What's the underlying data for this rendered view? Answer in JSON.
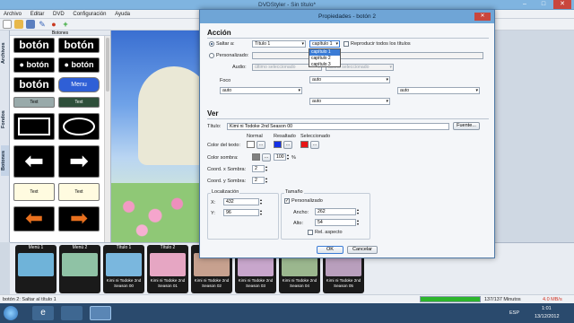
{
  "window": {
    "title": "DVDStyler - Sin título*",
    "minimize": "–",
    "maximize": "□",
    "close": "✕"
  },
  "menu": [
    "Archivo",
    "Editar",
    "DVD",
    "Configuración",
    "Ayuda"
  ],
  "left_tabs": [
    "Archivos",
    "Fondos",
    "Botones"
  ],
  "buttons_panel": {
    "header": "Botones",
    "items": [
      {
        "label": "botón"
      },
      {
        "label": "botón"
      },
      {
        "label": "● botón"
      },
      {
        "label": "● botón"
      },
      {
        "label": "botón"
      },
      {
        "label": "Menu"
      },
      {
        "label": "Text"
      },
      {
        "label": "Text"
      },
      {
        "label": ""
      },
      {
        "label": ""
      },
      {
        "label": ""
      },
      {
        "label": ""
      },
      {
        "label": "Text"
      },
      {
        "label": "Text"
      },
      {
        "label": ""
      },
      {
        "label": ""
      }
    ]
  },
  "thumbnails": [
    {
      "top": "Menú 1",
      "cap": "",
      "color": "#6fb3d9"
    },
    {
      "top": "Menú 2",
      "cap": "",
      "color": "#8fc2a5"
    },
    {
      "top": "Título 1",
      "cap": "Kimi ni Todoke 2nd Season 00",
      "color": "#7ab7de"
    },
    {
      "top": "Título 2",
      "cap": "Kimi ni Todoke 2nd Season 01",
      "color": "#e6a6c3"
    },
    {
      "top": "",
      "cap": "Kimi ni Todoke 2nd Season 02",
      "color": "#c7a18f"
    },
    {
      "top": "",
      "cap": "Kimi ni Todoke 2nd Season 03",
      "color": "#c8a6cc"
    },
    {
      "top": "",
      "cap": "Kimi ni Todoke 2nd Season 04",
      "color": "#9bb78e"
    },
    {
      "top": "",
      "cap": "Kimi ni Todoke 2nd Season 05",
      "color": "#b99fbd"
    }
  ],
  "status": {
    "text": "botón 2: Saltar al título 1",
    "minutes": "137/137 Minutos",
    "size": "4.0 MB/s",
    "progress": 1.0
  },
  "taskbar": {
    "lang": "ESP",
    "time": "1:01",
    "date": "13/12/2012"
  },
  "dialog": {
    "title": "Propiedades - botón 2",
    "close": "✕",
    "accion": {
      "heading": "Acción",
      "saltar_label": "Saltar a:",
      "saltar_target": "Título 1",
      "capitulo_value": "capítulo 1",
      "reproducir_label": "Reproducir todos los títulos",
      "dropdown_options": [
        "capítulo 1",
        "capítulo 2",
        "capítulo 3"
      ],
      "personalizado_label": "Personalizado:",
      "audio_label": "Audio:",
      "audio_value": "último seleccionado",
      "subtitulo_value": "último seleccionado",
      "foco_label": "Foco",
      "foco_up": "auto",
      "foco_left": "auto",
      "foco_center": "auto",
      "foco_right": "auto",
      "foco_down": "auto"
    },
    "ver": {
      "heading": "Ver",
      "titulo_label": "Título:",
      "titulo_value": "Kimi ni Todoke 2nd Season 00",
      "fuente_btn": "Fuente...",
      "col_normal": "Normal",
      "col_resaltado": "Resaltado",
      "col_seleccionado": "Seleccionado",
      "color_texto_label": "Color del texto:",
      "color_normal": "#ffffff",
      "color_resaltado": "#1330e6",
      "color_seleccionado": "#e81515",
      "color_sombra_label": "Color sombra:",
      "color_sombra": "#808080",
      "sombra_pct": "100",
      "pct": "%",
      "coord_x_label": "Coord. x Sombra:",
      "coord_x": "2",
      "coord_y_label": "Coord. y Sombra:",
      "coord_y": "2",
      "ellipsis": "..."
    },
    "localizacion": {
      "heading": "Localización",
      "x_label": "X:",
      "x": "432",
      "y_label": "Y:",
      "y": "96"
    },
    "tamano": {
      "heading": "Tamaño",
      "personalizado": "Personalizado",
      "ancho_label": "Ancho:",
      "ancho": "262",
      "alto_label": "Alto:",
      "alto": "54",
      "rel_aspecto": "Rel. aspecto"
    },
    "ok": "OK",
    "cancel": "Cancelar"
  }
}
